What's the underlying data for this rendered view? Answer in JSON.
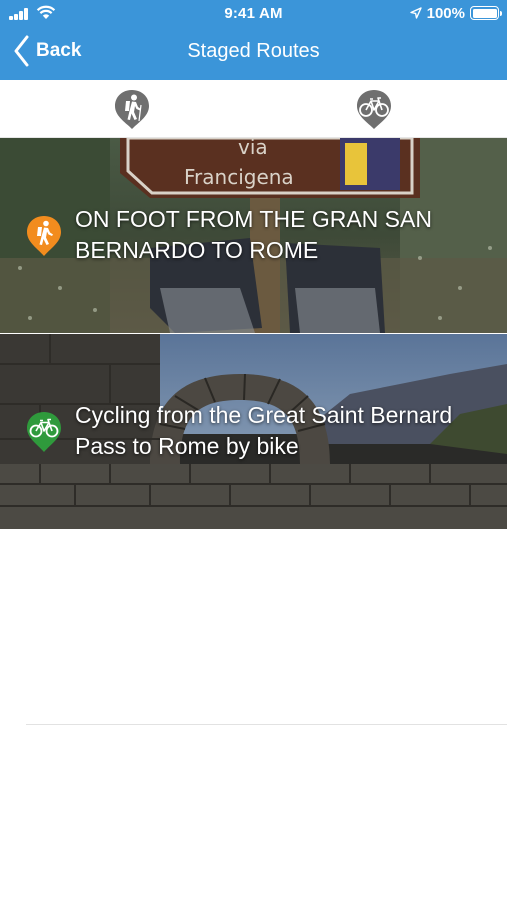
{
  "status_bar": {
    "time": "9:41 AM",
    "battery": "100%"
  },
  "nav": {
    "back_label": "Back",
    "title": "Staged Routes"
  },
  "filters": [
    {
      "name": "on-foot",
      "icon": "hiker-icon"
    },
    {
      "name": "by-bike",
      "icon": "bicycle-icon"
    }
  ],
  "routes": [
    {
      "title": "ON FOOT FROM THE GRAN SAN BERNARDO TO ROME",
      "icon": "hiker-pin-icon",
      "pin_color": "#f28c1e",
      "image_sign_line1": "via",
      "image_sign_line2": "Francigena"
    },
    {
      "title": "Cycling from the Great Saint Bernard Pass to Rome by bike",
      "icon": "bicycle-pin-icon",
      "pin_color": "#2f9a3c"
    }
  ],
  "colors": {
    "header": "#3b95d9",
    "filter_icon": "#6f6f6f"
  }
}
